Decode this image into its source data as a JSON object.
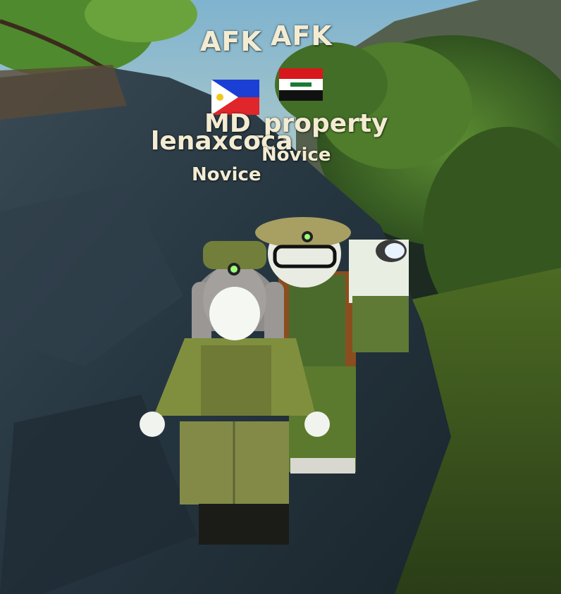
{
  "players": [
    {
      "status": "AFK",
      "flag_icon": "philippines-flag-icon",
      "username": "lenaxcoca",
      "rank": "Novice"
    },
    {
      "status": "AFK",
      "flag_icon": "iraq-flag-icon",
      "username": "MD_property",
      "rank": "Novice"
    }
  ],
  "colors": {
    "nametag_text": "#f3ecd2",
    "sky": "#7fb3cf",
    "rock": "#2c3a44",
    "foliage": "#3f6b2a",
    "uniform": "#6f7a3a"
  }
}
